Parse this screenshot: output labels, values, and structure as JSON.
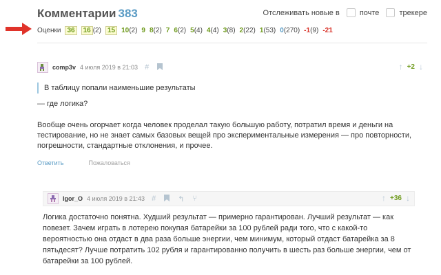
{
  "header": {
    "title": "Комментарии",
    "count": "383",
    "follow_label": "Отслеживать новые в",
    "option_mail": "почте",
    "option_tracker": "трекере"
  },
  "ratings": {
    "label": "Оценки",
    "items": [
      {
        "score": "36",
        "count": "",
        "kind": "pos",
        "boxed": true
      },
      {
        "score": "16",
        "count": "(2)",
        "kind": "pos",
        "boxed": true
      },
      {
        "score": "15",
        "count": "",
        "kind": "pos",
        "boxed": true
      },
      {
        "score": "10",
        "count": "(2)",
        "kind": "pos",
        "boxed": false
      },
      {
        "score": "9",
        "count": "",
        "kind": "pos",
        "boxed": false
      },
      {
        "score": "8",
        "count": "(2)",
        "kind": "pos",
        "boxed": false
      },
      {
        "score": "7",
        "count": "",
        "kind": "pos",
        "boxed": false
      },
      {
        "score": "6",
        "count": "(2)",
        "kind": "pos",
        "boxed": false
      },
      {
        "score": "5",
        "count": "(4)",
        "kind": "pos",
        "boxed": false
      },
      {
        "score": "4",
        "count": "(4)",
        "kind": "pos",
        "boxed": false
      },
      {
        "score": "3",
        "count": "(8)",
        "kind": "pos",
        "boxed": false
      },
      {
        "score": "2",
        "count": "(22)",
        "kind": "pos",
        "boxed": false
      },
      {
        "score": "1",
        "count": "(53)",
        "kind": "pos",
        "boxed": false
      },
      {
        "score": "0",
        "count": "(270)",
        "kind": "neutral",
        "boxed": false
      },
      {
        "score": "-1",
        "count": "(9)",
        "kind": "neg",
        "boxed": false
      },
      {
        "score": "-21",
        "count": "",
        "kind": "neg",
        "boxed": false
      }
    ]
  },
  "comment1": {
    "username": "comp3v",
    "date": "4 июля 2019 в 21:03",
    "score": "+2",
    "quote": "В таблицу попали наименьшие результаты",
    "p1": "— где логика?",
    "p2": "Вообще очень огорчает когда человек проделал такую большую работу, потратил время и деньги на тестирование, но не знает самых базовых вещей про экспериментальные измерения — про повторности, погрешности, стандартные отклонения, и прочее.",
    "reply": "Ответить",
    "complain": "Пожаловаться"
  },
  "comment2": {
    "username": "Igor_O",
    "date": "4 июля 2019 в 21:43",
    "score": "+36",
    "text": "Логика достаточно понятна. Худший результат — примерно гарантирован. Лучший результат — как повезет. Зачем играть в лотерею покупая батарейки за 100 рублей ради того, что с какой-то вероятностью она отдаст в два раза больше энергии, чем минимум, который отдаст батарейка за 8 пятьдесят? Лучше потратить 102 рубля и гарантированно получить в шесть раз больше энергии, чем от батарейки за 100 рублей."
  },
  "colors": {
    "accent": "#5a9bc4",
    "positive": "#6e9a1c",
    "negative": "#d9342b",
    "arrow": "#e0332a"
  },
  "icons": [
    "arrow-right-icon",
    "hash-icon",
    "bookmark-icon",
    "parent-link-icon",
    "branch-icon",
    "vote-up-icon",
    "vote-down-icon",
    "avatar-icon"
  ]
}
